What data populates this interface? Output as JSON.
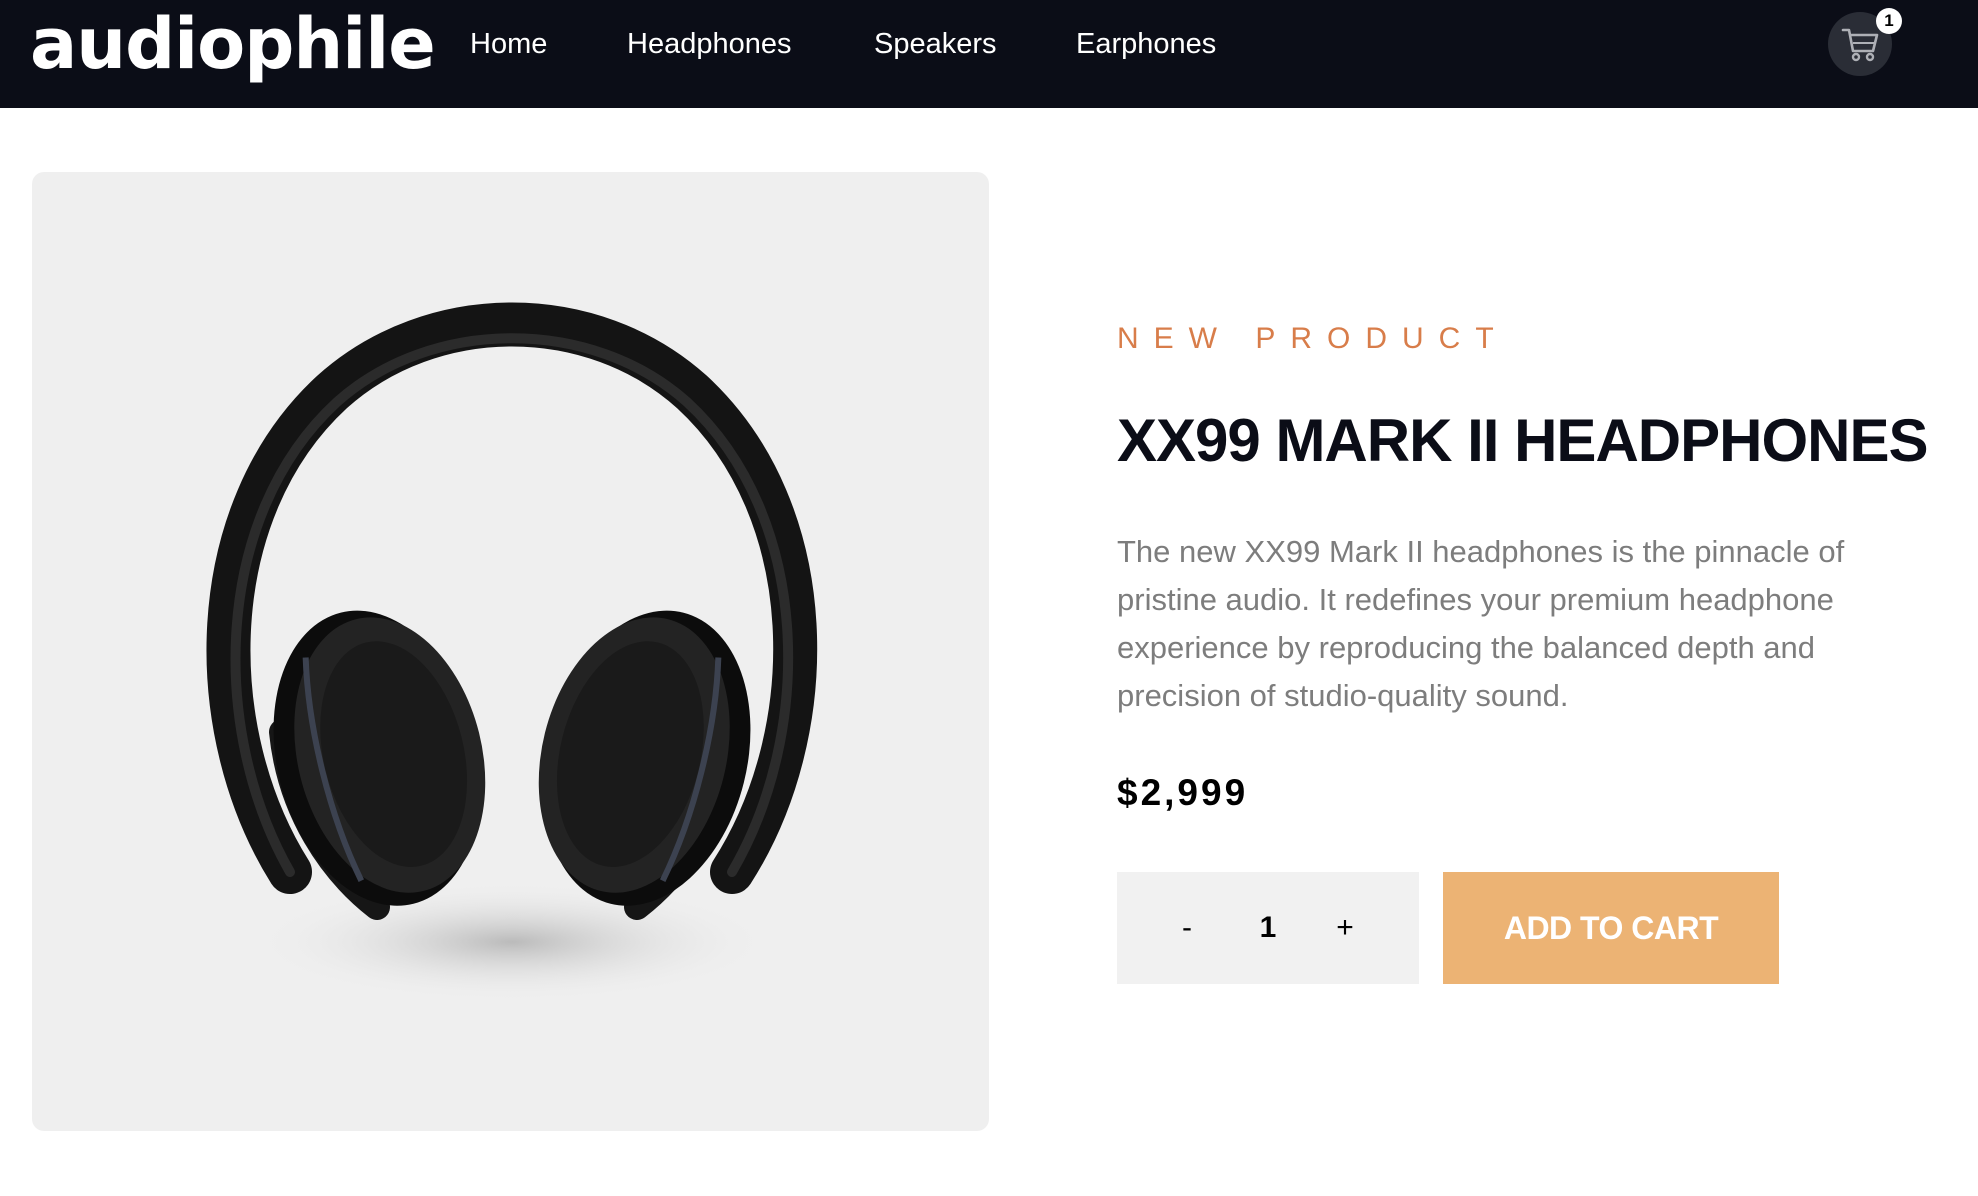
{
  "brand": {
    "logo_text": "audiophile"
  },
  "nav": {
    "items": [
      {
        "label": "Home"
      },
      {
        "label": "Headphones"
      },
      {
        "label": "Speakers"
      },
      {
        "label": "Earphones"
      }
    ]
  },
  "cart": {
    "icon": "cart-icon",
    "count": "1"
  },
  "product": {
    "image_icon": "headphones-image",
    "overline": "NEW PRODUCT",
    "name": "XX99 MARK II HEADPHONES",
    "description": "The new XX99 Mark II headphones is the pinnacle of pristine audio. It redefines your premium headphone experience by reproducing the balanced depth and precision of studio-quality sound.",
    "price": "$2,999",
    "quantity": {
      "decrement_label": "-",
      "value": "1",
      "increment_label": "+"
    },
    "add_to_cart_label": "ADD TO CART"
  },
  "colors": {
    "header_bg": "#0b0d17",
    "accent": "#d87d4a",
    "button_bg": "#ecb374",
    "image_bg": "#efefef"
  }
}
